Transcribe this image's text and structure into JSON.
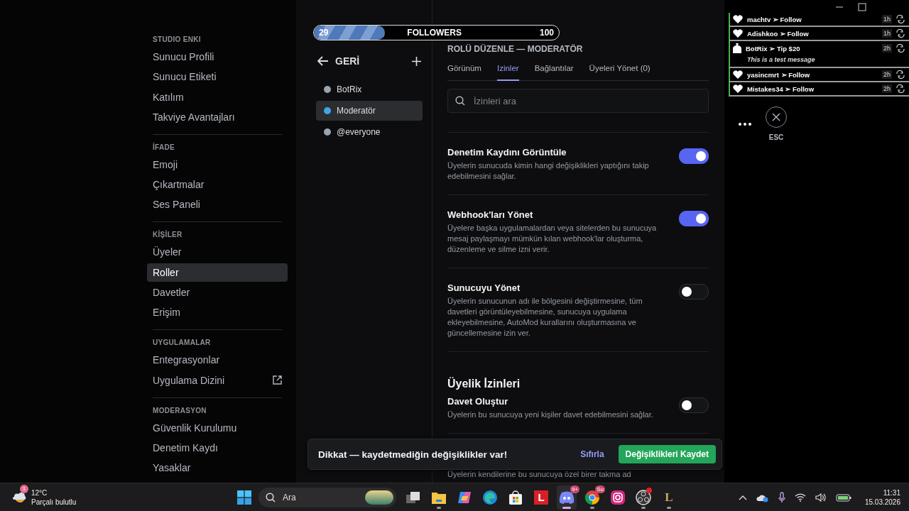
{
  "followers_bar": {
    "current": "29",
    "label": "FOLLOWERS",
    "goal": "100",
    "level": 0.29
  },
  "settings_nav": {
    "sections": [
      {
        "heading": "STUDIO ENKI",
        "items": [
          {
            "label": "Sunucu Profili",
            "selected": false
          },
          {
            "label": "Sunucu Etiketi",
            "selected": false
          },
          {
            "label": "Katılım",
            "selected": false
          },
          {
            "label": "Takviye Avantajları",
            "selected": false
          }
        ]
      },
      {
        "heading": "İFADE",
        "items": [
          {
            "label": "Emoji",
            "selected": false
          },
          {
            "label": "Çıkartmalar",
            "selected": false
          },
          {
            "label": "Ses Paneli",
            "selected": false
          }
        ]
      },
      {
        "heading": "KİŞİLER",
        "items": [
          {
            "label": "Üyeler",
            "selected": false
          },
          {
            "label": "Roller",
            "selected": true
          },
          {
            "label": "Davetler",
            "selected": false
          },
          {
            "label": "Erişim",
            "selected": false
          }
        ]
      },
      {
        "heading": "UYGULAMALAR",
        "items": [
          {
            "label": "Entegrasyonlar",
            "selected": false
          },
          {
            "label": "Uygulama Dizini",
            "selected": false,
            "external": true
          }
        ]
      },
      {
        "heading": "MODERASYON",
        "items": [
          {
            "label": "Güvenlik Kurulumu",
            "selected": false
          },
          {
            "label": "Denetim Kaydı",
            "selected": false
          },
          {
            "label": "Yasaklar",
            "selected": false
          }
        ]
      }
    ]
  },
  "roles": {
    "back_label": "GERİ",
    "items": [
      {
        "name": "BotRix",
        "color": "#9ba3ad",
        "selected": false
      },
      {
        "name": "Moderatör",
        "color": "#3ba7e8",
        "selected": true
      },
      {
        "name": "@everyone",
        "color": "#9ba3ad",
        "selected": false
      }
    ]
  },
  "editor": {
    "title": "ROLÜ DÜZENLE — MODERATÖR",
    "tabs": [
      {
        "label": "Görünüm",
        "selected": false
      },
      {
        "label": "Izinler",
        "selected": true
      },
      {
        "label": "Bağlantılar",
        "selected": false
      },
      {
        "label": "Üyeleri Yönet (0)",
        "selected": false
      }
    ],
    "search": {
      "placeholder": "İzinleri ara"
    },
    "permissions": [
      {
        "kind": "toggle",
        "title": "Denetim Kaydını Görüntüle",
        "description": "Üyelerin sunucuda kimin hangi değişiklikleri yaptığını takip edebilmesini sağlar.",
        "on": true
      },
      {
        "kind": "toggle",
        "title": "Webhook'ları Yönet",
        "description": "Üyelere başka uygulamalardan veya sitelerden bu sunucuya mesaj paylaşmayı mümkün kılan webhook'lar oluşturma, düzenleme ve silme izni verir.",
        "on": true
      },
      {
        "kind": "toggle",
        "title": "Sunucuyu Yönet",
        "description": "Üyelerin sunucunun adı ile bölgesini değiştirmesine, tüm davetleri görüntüleyebilmesine, sunucuya uygulama ekleyebilmesine, AutoMod kurallarını oluşturmasına ve güncellemesine izin ver.",
        "on": false
      },
      {
        "kind": "header",
        "title": "Üyelik İzinleri"
      },
      {
        "kind": "toggle",
        "title": "Davet Oluştur",
        "description": "Üyelerin bu sunucuya yeni kişiler davet edebilmesini sağlar.",
        "on": false
      },
      {
        "kind": "partial",
        "description": "Üyelerin kendilerine bu sunucuya özel birer takma ad"
      }
    ]
  },
  "unsaved_bar": {
    "message": "Dikkat — kaydetmediğin değişiklikler var!",
    "reset": "Sıfırla",
    "save": "Değişiklikleri Kaydet"
  },
  "alert_feed": {
    "items": [
      {
        "kind": "follow",
        "text": "machtv ➢ Follow",
        "time": "1h"
      },
      {
        "kind": "follow",
        "text": "Adishkoo ➢ Follow",
        "time": "1h"
      },
      {
        "kind": "tip",
        "text": "BotRix ➢ Tip $20",
        "message": "This is a test message",
        "time": "2h"
      },
      {
        "kind": "follow",
        "text": "yasincmrt ➢ Follow",
        "time": "2h"
      },
      {
        "kind": "follow",
        "text": "Mistakes34 ➢ Follow",
        "time": "2h"
      }
    ]
  },
  "close_button": {
    "label": "ESC"
  },
  "taskbar": {
    "weather": {
      "badge": "1",
      "temp": "12°C",
      "condition": "Parçalı bulutlu"
    },
    "search": {
      "placeholder": "Ara"
    },
    "apps": [
      {
        "kind": "taskview",
        "running": false,
        "active": false
      },
      {
        "kind": "explorer",
        "running": true,
        "active": false
      },
      {
        "kind": "copilot",
        "running": false,
        "active": false
      },
      {
        "kind": "edge",
        "running": false,
        "active": false
      },
      {
        "kind": "store",
        "running": false,
        "active": false
      },
      {
        "kind": "letter",
        "label": "L",
        "running": false,
        "active": false
      },
      {
        "kind": "discord",
        "badge": "9+",
        "running": true,
        "active": true
      },
      {
        "kind": "chrome",
        "badge": "Su",
        "running": true,
        "active": false
      },
      {
        "kind": "instagram",
        "running": false,
        "active": false
      },
      {
        "kind": "obs",
        "dot": true,
        "running": true,
        "active": false
      },
      {
        "kind": "league",
        "label": "L",
        "running": true,
        "active": false
      }
    ],
    "time": "11:31",
    "date": "15.03.2026"
  }
}
